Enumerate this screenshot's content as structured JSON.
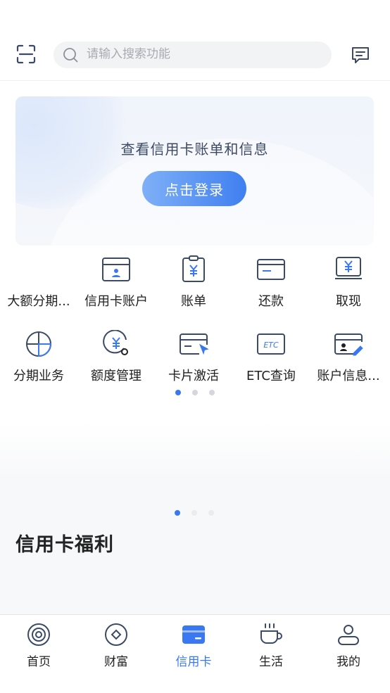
{
  "header": {
    "scan_icon": "scan-icon",
    "search_placeholder": "请输入搜索功能",
    "message_icon": "message-icon"
  },
  "banner": {
    "title": "查看信用卡账单和信息",
    "login_label": "点击登录"
  },
  "grid": {
    "row1": [
      {
        "label": "大额分期...",
        "icon": "installment-large-icon"
      },
      {
        "label": "信用卡账户",
        "icon": "card-account-icon"
      },
      {
        "label": "账单",
        "icon": "bill-icon"
      },
      {
        "label": "还款",
        "icon": "repay-icon"
      },
      {
        "label": "取现",
        "icon": "cash-withdraw-icon"
      }
    ],
    "row2": [
      {
        "label": "分期业务",
        "icon": "installment-icon"
      },
      {
        "label": "额度管理",
        "icon": "limit-manage-icon"
      },
      {
        "label": "卡片激活",
        "icon": "card-activate-icon"
      },
      {
        "label": "ETC查询",
        "icon": "etc-icon",
        "badge": "ETC"
      },
      {
        "label": "账户信息...",
        "icon": "account-info-icon"
      }
    ]
  },
  "colors": {
    "accent": "#3a78f2",
    "text": "#222222",
    "icon_stroke": "#3c4a66"
  },
  "section": {
    "title": "信用卡福利"
  },
  "tabbar": {
    "items": [
      {
        "label": "首页",
        "icon": "home-icon"
      },
      {
        "label": "财富",
        "icon": "wealth-icon"
      },
      {
        "label": "信用卡",
        "icon": "credit-card-icon",
        "active": true
      },
      {
        "label": "生活",
        "icon": "life-cup-icon"
      },
      {
        "label": "我的",
        "icon": "profile-icon"
      }
    ]
  }
}
